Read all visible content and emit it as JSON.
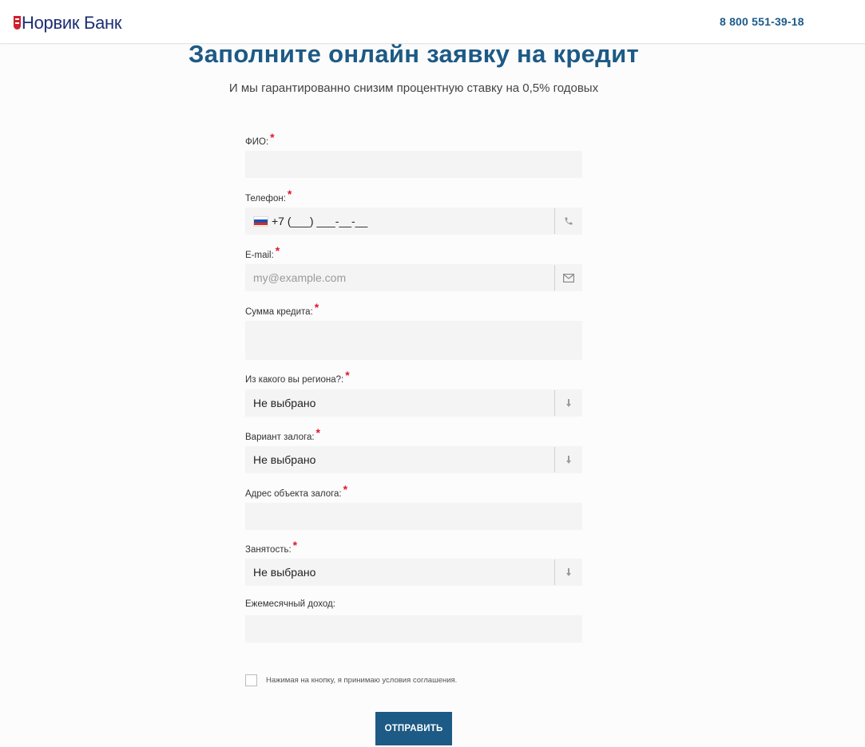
{
  "header": {
    "logo_text": "Норвик Банк",
    "phone": "8 800 551-39-18"
  },
  "main": {
    "title": "Заполните онлайн заявку на кредит",
    "subtitle": "И мы гарантированно снизим процентную ставку на 0,5% годовых"
  },
  "form": {
    "fio": {
      "label": "ФИО:",
      "required": "*",
      "value": ""
    },
    "phone": {
      "label": "Телефон:",
      "required": "*",
      "value": "+7 (___) ___-__-__",
      "icon": "phone-icon"
    },
    "email": {
      "label": "E-mail:",
      "required": "*",
      "placeholder": "my@example.com",
      "icon": "envelope-icon"
    },
    "amount": {
      "label": "Сумма кредита:",
      "required": "*",
      "value": ""
    },
    "region": {
      "label": "Из какого вы региона?:",
      "required": "*",
      "value": "Не выбрано",
      "icon": "sort-arrow-icon"
    },
    "collateral": {
      "label": "Вариант залога:",
      "required": "*",
      "value": "Не выбрано",
      "icon": "sort-arrow-icon"
    },
    "address": {
      "label": "Адрес объекта залога:",
      "required": "*",
      "value": ""
    },
    "employment": {
      "label": "Занятость:",
      "required": "*",
      "value": "Не выбрано",
      "icon": "sort-arrow-icon"
    },
    "income": {
      "label": "Ежемесячный доход:",
      "value": ""
    },
    "agreement_text": "Нажимая на кнопку, я принимаю условия соглашения.",
    "submit_label": "ОТПРАВИТЬ"
  },
  "colors": {
    "brand_blue": "#1d5a85",
    "logo_blue": "#1d2f73",
    "required_red": "#e2172a",
    "field_bg": "#f4f4f4"
  }
}
